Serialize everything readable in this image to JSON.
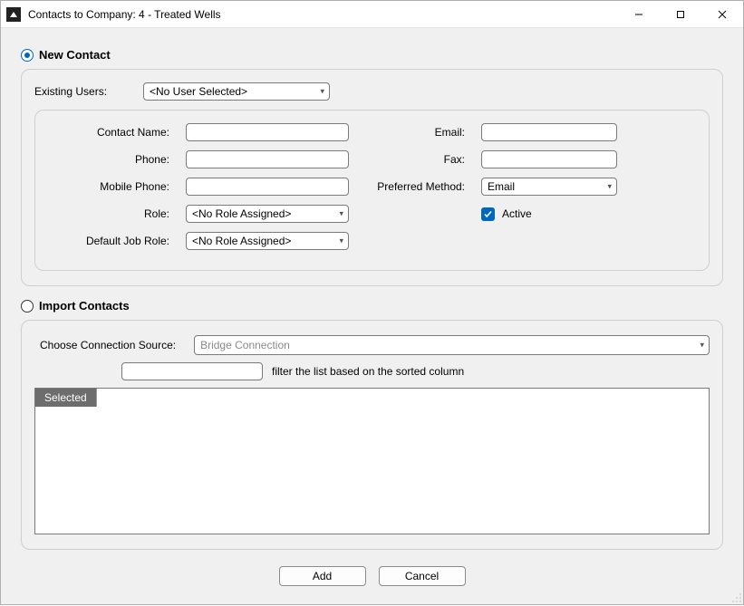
{
  "window": {
    "title": "Contacts to Company: 4 - Treated Wells"
  },
  "mode": {
    "new_contact_label": "New Contact",
    "import_contacts_label": "Import Contacts",
    "selected": "new_contact"
  },
  "existing": {
    "label": "Existing Users:",
    "value": "<No User Selected>"
  },
  "fields": {
    "contact_name": {
      "label": "Contact Name:",
      "value": ""
    },
    "phone": {
      "label": "Phone:",
      "value": ""
    },
    "mobile_phone": {
      "label": "Mobile Phone:",
      "value": ""
    },
    "role": {
      "label": "Role:",
      "value": "<No Role Assigned>"
    },
    "default_job_role": {
      "label": "Default Job Role:",
      "value": "<No Role Assigned>"
    },
    "email": {
      "label": "Email:",
      "value": ""
    },
    "fax": {
      "label": "Fax:",
      "value": ""
    },
    "preferred_method": {
      "label": "Preferred Method:",
      "value": "Email"
    },
    "active": {
      "label": "Active",
      "checked": true
    }
  },
  "import": {
    "source_label": "Choose Connection Source:",
    "source_value": "Bridge Connection",
    "filter_value": "",
    "filter_hint": "filter the list based on the sorted column",
    "table": {
      "columns": [
        "Selected"
      ],
      "rows": []
    }
  },
  "buttons": {
    "add": "Add",
    "cancel": "Cancel"
  }
}
